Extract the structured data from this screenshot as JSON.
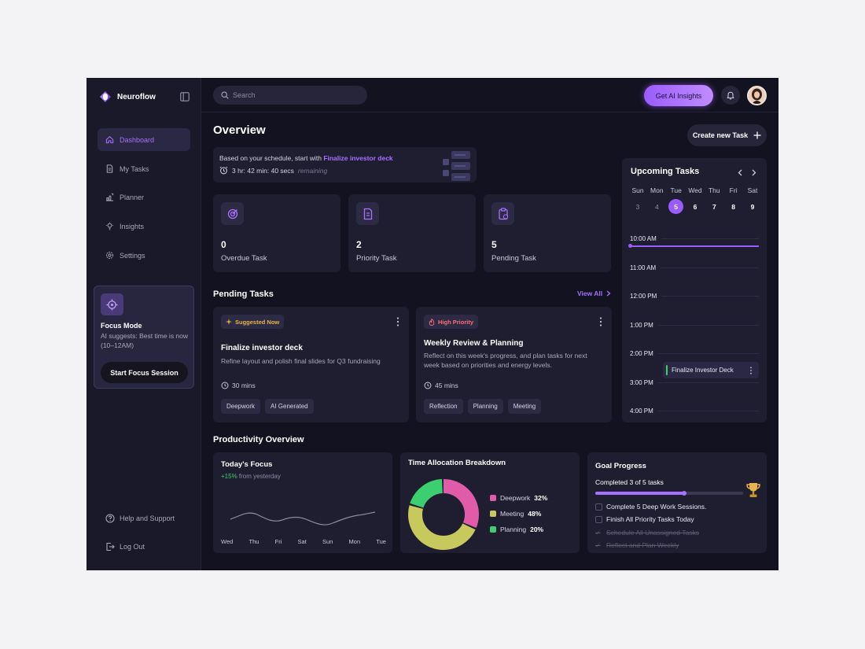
{
  "brand": {
    "name": "Neuroflow"
  },
  "sidebar": {
    "items": [
      {
        "label": "Dashboard"
      },
      {
        "label": "My Tasks"
      },
      {
        "label": "Planner"
      },
      {
        "label": "Insights"
      },
      {
        "label": "Settings"
      }
    ],
    "focus": {
      "title": "Focus Mode",
      "text": "AI suggests: Best time is now (10–12AM)",
      "button": "Start Focus Session"
    },
    "help": "Help and Support",
    "logout": "Log Out"
  },
  "topbar": {
    "search_placeholder": "Search",
    "ai_button": "Get AI Insights"
  },
  "overview": {
    "title": "Overview",
    "create_button": "Create new Task",
    "banner": {
      "prefix": "Based on your schedule, start with",
      "task": "Finalize investor deck",
      "countdown": "3 hr: 42 min: 40 secs",
      "remaining": "remaining"
    },
    "stats": [
      {
        "value": "0",
        "label": "Overdue Task"
      },
      {
        "value": "2",
        "label": "Priority Task"
      },
      {
        "value": "5",
        "label": "Pending Task"
      }
    ]
  },
  "pending": {
    "title": "Pending Tasks",
    "view_all": "View All",
    "tasks": [
      {
        "badge": "Suggested Now",
        "badge_color": "#e7b34a",
        "title": "Finalize investor deck",
        "desc": "Refine layout and polish final slides for Q3 fundraising",
        "time": "30 mins",
        "tags": [
          "Deepwork",
          "AI Generated"
        ]
      },
      {
        "badge": "High Priority",
        "badge_color": "#ff6b7d",
        "title": "Weekly Review & Planning",
        "desc": "Reflect on this week's progress, and plan tasks for next week based on priorities and energy levels.",
        "time": "45 mins",
        "tags": [
          "Reflection",
          "Planning",
          "Meeting"
        ]
      }
    ]
  },
  "upcoming": {
    "title": "Upcoming Tasks",
    "days": [
      {
        "name": "Sun",
        "num": "3"
      },
      {
        "name": "Mon",
        "num": "4"
      },
      {
        "name": "Tue",
        "num": "5"
      },
      {
        "name": "Wed",
        "num": "6"
      },
      {
        "name": "Thu",
        "num": "7"
      },
      {
        "name": "Fri",
        "num": "8"
      },
      {
        "name": "Sat",
        "num": "9"
      }
    ],
    "times": [
      "10:00 AM",
      "11:00 AM",
      "12:00 PM",
      "1:00 PM",
      "2:00 PM",
      "3:00 PM",
      "4:00 PM"
    ],
    "event": "Finalize Investor Deck"
  },
  "productivity": {
    "title": "Productivity Overview",
    "focus": {
      "title": "Today's Focus",
      "delta": "+15%",
      "delta_suffix": "from yesterday",
      "days": [
        "Wed",
        "Thu",
        "Fri",
        "Sat",
        "Sun",
        "Mon",
        "Tue"
      ]
    },
    "allocation": {
      "title": "Time Allocation Breakdown",
      "items": [
        {
          "name": "Deepwork",
          "pct": "32%",
          "value": 32,
          "color": "#e05ca8"
        },
        {
          "name": "Meeting",
          "pct": "48%",
          "value": 48,
          "color": "#c8c95c"
        },
        {
          "name": "Planning",
          "pct": "20%",
          "value": 20,
          "color": "#3ccf70"
        }
      ]
    },
    "goal": {
      "title": "Goal Progress",
      "subtitle": "Completed 3 of 5 tasks",
      "progress": 0.6,
      "items": [
        {
          "label": "Complete 5 Deep Work Sessions.",
          "done": false
        },
        {
          "label": "Finish All Priority Tasks Today",
          "done": false
        },
        {
          "label": "Schedule All Unassigned Tasks",
          "done": true
        },
        {
          "label": "Reflect and Plan Weekly",
          "done": true
        }
      ]
    }
  },
  "colors": {
    "accent": "#9b5cff",
    "bg": "#131220",
    "card": "#1f1e30"
  }
}
